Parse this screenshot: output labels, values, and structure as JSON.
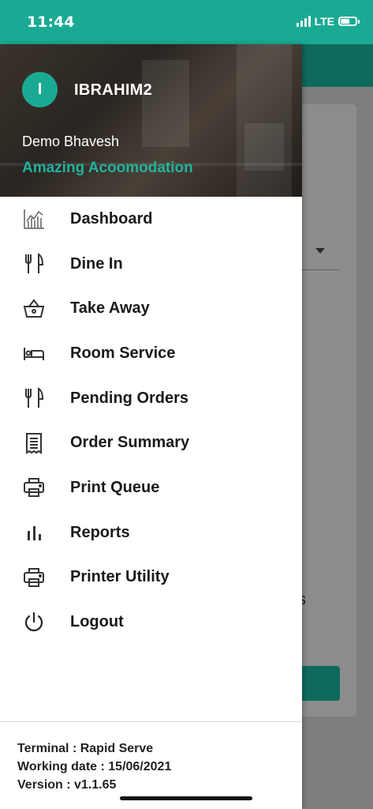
{
  "status_bar": {
    "time": "11:44",
    "network": "LTE",
    "battery_level_percent": 60,
    "color": "#1aaa94"
  },
  "drawer": {
    "avatar_initial": "I",
    "username": "IBRAHIM2",
    "user_fullname": "Demo Bhavesh",
    "property_name": "Amazing Acoomodation",
    "accent_color": "#1aaa94",
    "menu_items": [
      {
        "label": "Dashboard",
        "icon": "dashboard-chart-icon"
      },
      {
        "label": "Dine In",
        "icon": "fork-knife-icon"
      },
      {
        "label": "Take Away",
        "icon": "basket-icon"
      },
      {
        "label": "Room Service",
        "icon": "bed-icon"
      },
      {
        "label": "Pending Orders",
        "icon": "fork-knife-icon"
      },
      {
        "label": "Order Summary",
        "icon": "receipt-icon"
      },
      {
        "label": "Print Queue",
        "icon": "printer-icon"
      },
      {
        "label": "Reports",
        "icon": "bar-chart-icon"
      },
      {
        "label": "Printer Utility",
        "icon": "printer-icon"
      },
      {
        "label": "Logout",
        "icon": "power-icon"
      }
    ],
    "footer": {
      "terminal": "Terminal : Rapid Serve",
      "working_date": "Working date : 15/06/2021",
      "version": "Version : v1.1.65"
    }
  },
  "background_app": {
    "partial_text": "s"
  }
}
